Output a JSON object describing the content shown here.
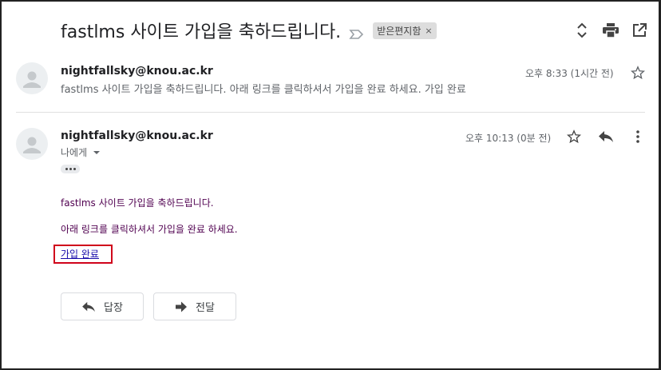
{
  "thread": {
    "subject": "fastlms 사이트 가입을 축하드립니다.",
    "label": "받은편지함",
    "label_close": "×"
  },
  "icons": {
    "importance": "importance-marker-icon",
    "nav": "expand-collapse-icon",
    "print": "print-icon",
    "new_window": "open-in-new-window-icon"
  },
  "messages": [
    {
      "sender": "nightfallsky@knou.ac.kr",
      "snippet": "fastlms 사이트 가입을 축하드립니다. 아래 링크를 클릭하셔서 가입을 완료 하세요. 가입 완료",
      "time": "오후 8:33 (1시간 전)"
    },
    {
      "sender": "nightfallsky@knou.ac.kr",
      "to": "나에게",
      "time": "오후 10:13 (0분 전)",
      "body": [
        "fastlms 사이트 가입을 축하드립니다.",
        "아래 링크를 클릭하셔서 가입을 완료 하세요."
      ],
      "link": "가입 완료"
    }
  ],
  "actions": {
    "reply": "답장",
    "forward": "전달"
  },
  "colors": {
    "highlight_border": "#d0021b",
    "body_text": "#500050",
    "link": "#1a0dab"
  }
}
